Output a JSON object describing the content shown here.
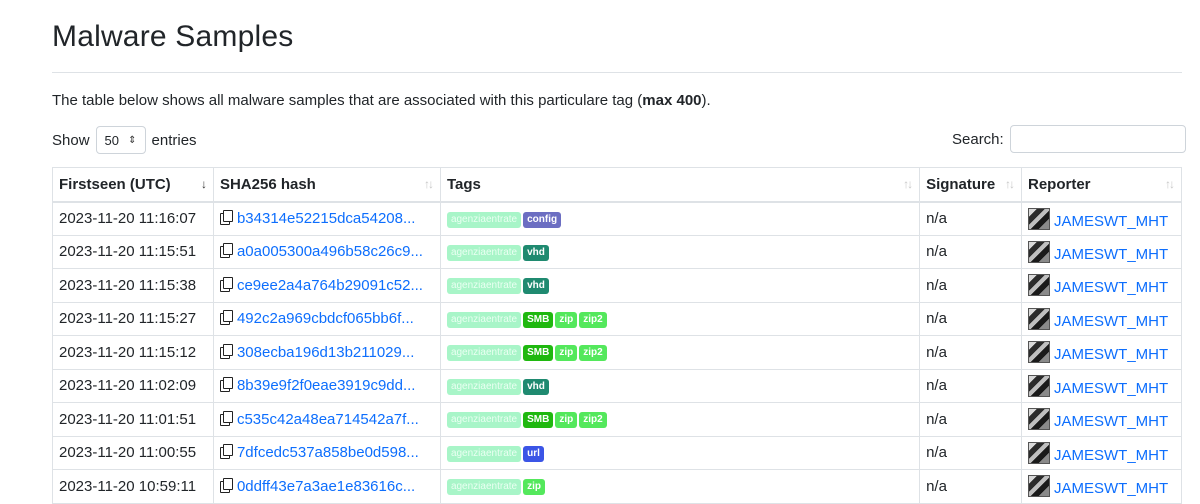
{
  "page": {
    "title": "Malware Samples",
    "description_prefix": "The table below shows all malware samples that are associated with this particulare tag (",
    "description_bold": "max 400",
    "description_suffix": ")."
  },
  "controls": {
    "show_label": "Show",
    "entries_value": "50",
    "entries_label": "entries",
    "search_label": "Search:",
    "search_value": ""
  },
  "table": {
    "headers": [
      "Firstseen (UTC)",
      "SHA256 hash",
      "Tags",
      "Signature",
      "Reporter"
    ],
    "rows": [
      {
        "firstseen": "2023-11-20 11:16:07",
        "hash": "b34314e52215dca54208...",
        "tags": [
          "agenziaentrate",
          "config"
        ],
        "signature": "n/a",
        "reporter": "JAMESWT_MHT"
      },
      {
        "firstseen": "2023-11-20 11:15:51",
        "hash": "a0a005300a496b58c26c9...",
        "tags": [
          "agenziaentrate",
          "vhd"
        ],
        "signature": "n/a",
        "reporter": "JAMESWT_MHT"
      },
      {
        "firstseen": "2023-11-20 11:15:38",
        "hash": "ce9ee2a4a764b29091c52...",
        "tags": [
          "agenziaentrate",
          "vhd"
        ],
        "signature": "n/a",
        "reporter": "JAMESWT_MHT"
      },
      {
        "firstseen": "2023-11-20 11:15:27",
        "hash": "492c2a969cbdcf065bb6f...",
        "tags": [
          "agenziaentrate",
          "SMB",
          "zip",
          "zip2"
        ],
        "signature": "n/a",
        "reporter": "JAMESWT_MHT"
      },
      {
        "firstseen": "2023-11-20 11:15:12",
        "hash": "308ecba196d13b211029...",
        "tags": [
          "agenziaentrate",
          "SMB",
          "zip",
          "zip2"
        ],
        "signature": "n/a",
        "reporter": "JAMESWT_MHT"
      },
      {
        "firstseen": "2023-11-20 11:02:09",
        "hash": "8b39e9f2f0eae3919c9dd...",
        "tags": [
          "agenziaentrate",
          "vhd"
        ],
        "signature": "n/a",
        "reporter": "JAMESWT_MHT"
      },
      {
        "firstseen": "2023-11-20 11:01:51",
        "hash": "c535c42a48ea714542a7f...",
        "tags": [
          "agenziaentrate",
          "SMB",
          "zip",
          "zip2"
        ],
        "signature": "n/a",
        "reporter": "JAMESWT_MHT"
      },
      {
        "firstseen": "2023-11-20 11:00:55",
        "hash": "7dfcedc537a858be0d598...",
        "tags": [
          "agenziaentrate",
          "url"
        ],
        "signature": "n/a",
        "reporter": "JAMESWT_MHT"
      },
      {
        "firstseen": "2023-11-20 10:59:11",
        "hash": "0ddff43e7a3ae1e83616c...",
        "tags": [
          "agenziaentrate",
          "zip"
        ],
        "signature": "n/a",
        "reporter": "JAMESWT_MHT"
      }
    ]
  },
  "colors": {
    "link": "#0d6efd",
    "tag_agenziaentrate": "#a8f5c8",
    "tag_config": "#6c6ec2",
    "tag_vhd": "#1f8a70",
    "tag_SMB": "#1fb80f",
    "tag_zip": "#54e85c",
    "tag_url": "#3b55e6"
  },
  "icons": {
    "copy": "copy-icon",
    "avatar": "reporter-avatar",
    "sort": "sort-icon"
  }
}
